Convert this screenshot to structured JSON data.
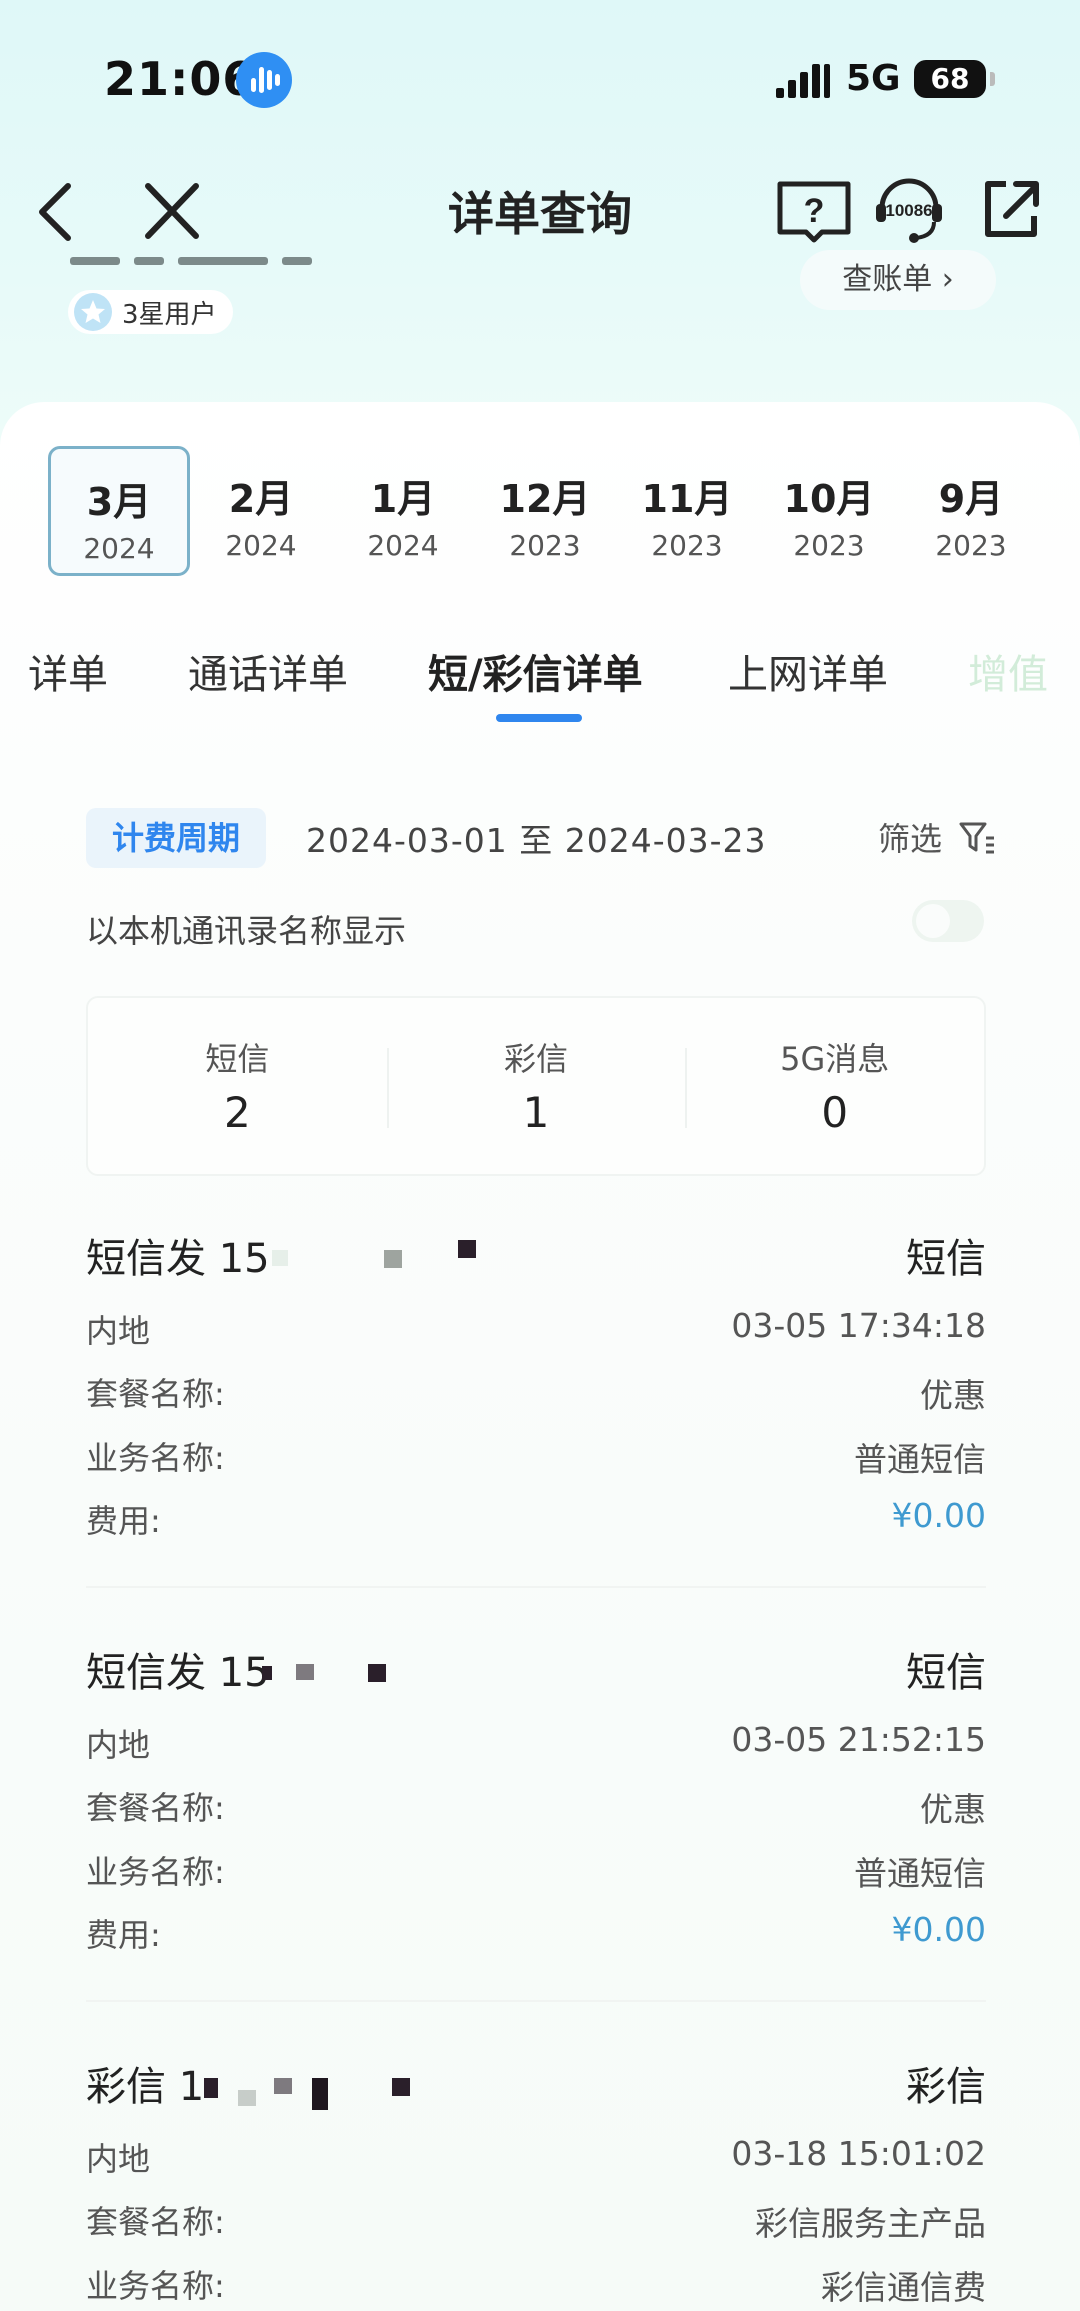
{
  "status_bar": {
    "time": "21:06",
    "network": "5G",
    "battery": "68"
  },
  "nav": {
    "title": "详单查询",
    "service_number": "10086"
  },
  "user": {
    "level": "3星用户",
    "bill_button": "查账单 ›"
  },
  "months": [
    {
      "label": "3月",
      "year": "2024",
      "active": true
    },
    {
      "label": "2月",
      "year": "2024"
    },
    {
      "label": "1月",
      "year": "2024"
    },
    {
      "label": "12月",
      "year": "2023"
    },
    {
      "label": "11月",
      "year": "2023"
    },
    {
      "label": "10月",
      "year": "2023"
    },
    {
      "label": "9月",
      "year": "2023"
    }
  ],
  "tabs": [
    {
      "label": "详单"
    },
    {
      "label": "通话详单"
    },
    {
      "label": "短/彩信详单",
      "active": true
    },
    {
      "label": "上网详单"
    },
    {
      "label": "增值"
    }
  ],
  "period": {
    "chip": "计费周期",
    "range": "2024-03-01  至  2024-03-23",
    "filter": "筛选"
  },
  "contact_toggle": {
    "label": "以本机通讯录名称显示",
    "enabled": false
  },
  "summary": [
    {
      "label": "短信",
      "value": "2"
    },
    {
      "label": "彩信",
      "value": "1"
    },
    {
      "label": "5G消息",
      "value": "0"
    }
  ],
  "records": [
    {
      "title": "短信发 15",
      "type": "短信",
      "region": "内地",
      "time": "03-05 17:34:18",
      "package_label": "套餐名称:",
      "package": "优惠",
      "service_label": "业务名称:",
      "service": "普通短信",
      "fee_label": "费用:",
      "fee": "¥0.00"
    },
    {
      "title": "短信发 15",
      "type": "短信",
      "region": "内地",
      "time": "03-05 21:52:15",
      "package_label": "套餐名称:",
      "package": "优惠",
      "service_label": "业务名称:",
      "service": "普通短信",
      "fee_label": "费用:",
      "fee": "¥0.00"
    },
    {
      "title": "彩信 1",
      "type": "彩信",
      "region": "内地",
      "time": "03-18 15:01:02",
      "package_label": "套餐名称:",
      "package": "彩信服务主产品",
      "service_label": "业务名称:",
      "service": "彩信通信费"
    }
  ]
}
